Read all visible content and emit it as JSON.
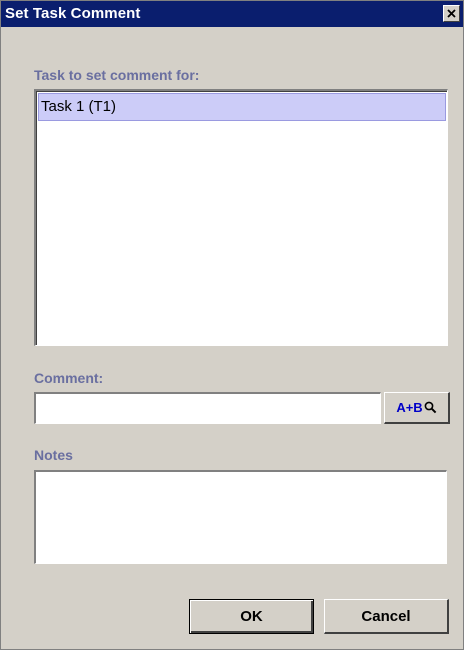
{
  "window": {
    "title": "Set Task Comment",
    "close_icon": "close-x-icon"
  },
  "task_section": {
    "label": "Task to set comment for:",
    "items": [
      {
        "label": "Task 1 (T1)",
        "selected": true
      }
    ]
  },
  "comment_section": {
    "label": "Comment:",
    "value": "",
    "spell_button_label": "A+B",
    "spell_button_icon": "magnifier-icon"
  },
  "notes_section": {
    "label": "Notes",
    "value": ""
  },
  "buttons": {
    "ok_label": "OK",
    "cancel_label": "Cancel"
  },
  "colors": {
    "titlebar": "#0a1e6e",
    "dialog_bg": "#d4d0c8",
    "section_label": "#6a6fa0",
    "selection": "#ccccf8",
    "spell_text": "#0000c8"
  }
}
